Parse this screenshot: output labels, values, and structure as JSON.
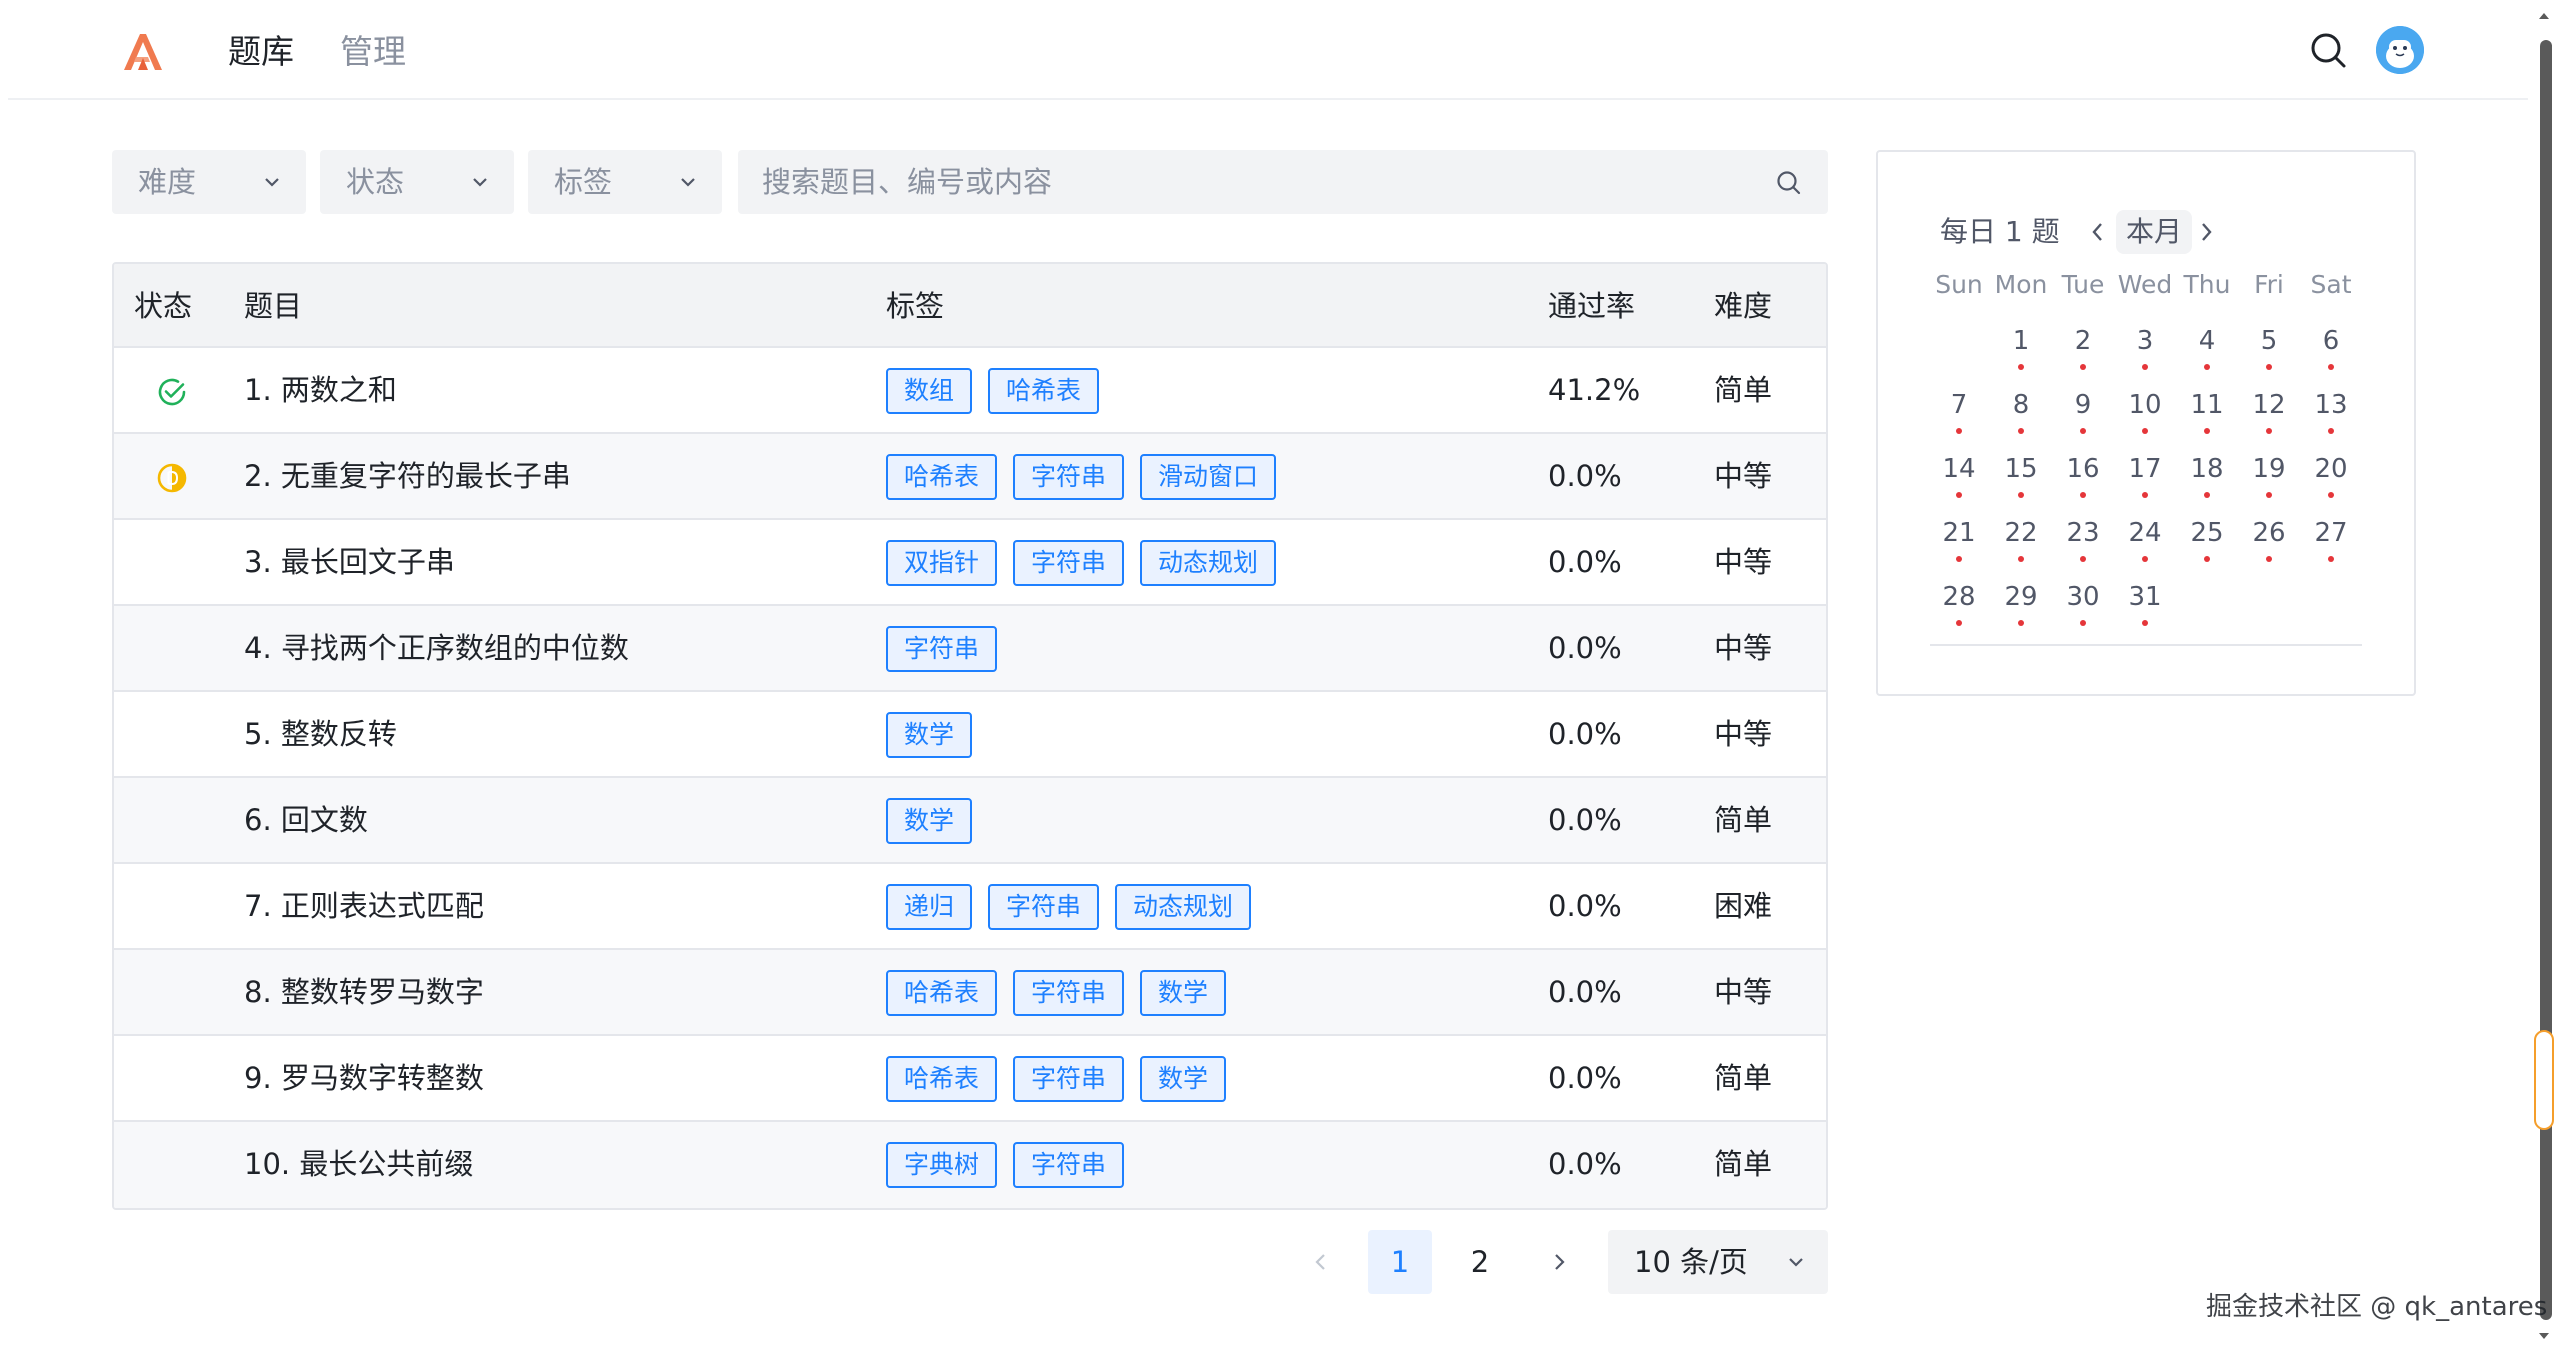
{
  "header": {
    "logo": "logo-mark",
    "nav": [
      {
        "label": "题库",
        "active": true
      },
      {
        "label": "管理",
        "active": false
      }
    ],
    "search_icon": "search-icon",
    "avatar_icon": "robot-avatar"
  },
  "filters": {
    "difficulty_label": "难度",
    "status_label": "状态",
    "tags_label": "标签",
    "search_placeholder": "搜索题目、编号或内容"
  },
  "table": {
    "columns": {
      "status": "状态",
      "title": "题目",
      "tags": "标签",
      "pass_rate": "通过率",
      "difficulty": "难度"
    },
    "rows": [
      {
        "status": "solved",
        "title": "1. 两数之和",
        "tags": [
          "数组",
          "哈希表"
        ],
        "pass_rate": "41.2%",
        "difficulty": "简单"
      },
      {
        "status": "attempted",
        "title": "2. 无重复字符的最长子串",
        "tags": [
          "哈希表",
          "字符串",
          "滑动窗口"
        ],
        "pass_rate": "0.0%",
        "difficulty": "中等"
      },
      {
        "status": "none",
        "title": "3. 最长回文子串",
        "tags": [
          "双指针",
          "字符串",
          "动态规划"
        ],
        "pass_rate": "0.0%",
        "difficulty": "中等"
      },
      {
        "status": "none",
        "title": "4. 寻找两个正序数组的中位数",
        "tags": [
          "字符串"
        ],
        "pass_rate": "0.0%",
        "difficulty": "中等"
      },
      {
        "status": "none",
        "title": "5. 整数反转",
        "tags": [
          "数学"
        ],
        "pass_rate": "0.0%",
        "difficulty": "中等"
      },
      {
        "status": "none",
        "title": "6. 回文数",
        "tags": [
          "数学"
        ],
        "pass_rate": "0.0%",
        "difficulty": "简单"
      },
      {
        "status": "none",
        "title": "7. 正则表达式匹配",
        "tags": [
          "递归",
          "字符串",
          "动态规划"
        ],
        "pass_rate": "0.0%",
        "difficulty": "困难"
      },
      {
        "status": "none",
        "title": "8. 整数转罗马数字",
        "tags": [
          "哈希表",
          "字符串",
          "数学"
        ],
        "pass_rate": "0.0%",
        "difficulty": "中等"
      },
      {
        "status": "none",
        "title": "9. 罗马数字转整数",
        "tags": [
          "哈希表",
          "字符串",
          "数学"
        ],
        "pass_rate": "0.0%",
        "difficulty": "简单"
      },
      {
        "status": "none",
        "title": "10. 最长公共前缀",
        "tags": [
          "字典树",
          "字符串"
        ],
        "pass_rate": "0.0%",
        "difficulty": "简单"
      }
    ]
  },
  "pagination": {
    "pages": [
      "1",
      "2"
    ],
    "current": "1",
    "page_size_label": "10 条/页"
  },
  "calendar": {
    "title": "每日 1 题",
    "month_label": "本月",
    "weekdays": [
      "Sun",
      "Mon",
      "Tue",
      "Wed",
      "Thu",
      "Fri",
      "Sat"
    ],
    "first_weekday_index": 1,
    "days_in_month": 31
  },
  "colors": {
    "accent": "#1e80ff",
    "solved": "#20b15a",
    "attempted": "#f5b800",
    "calendar_dot": "#e5363a"
  },
  "watermark": "掘金技术社区 @ qk_antares"
}
